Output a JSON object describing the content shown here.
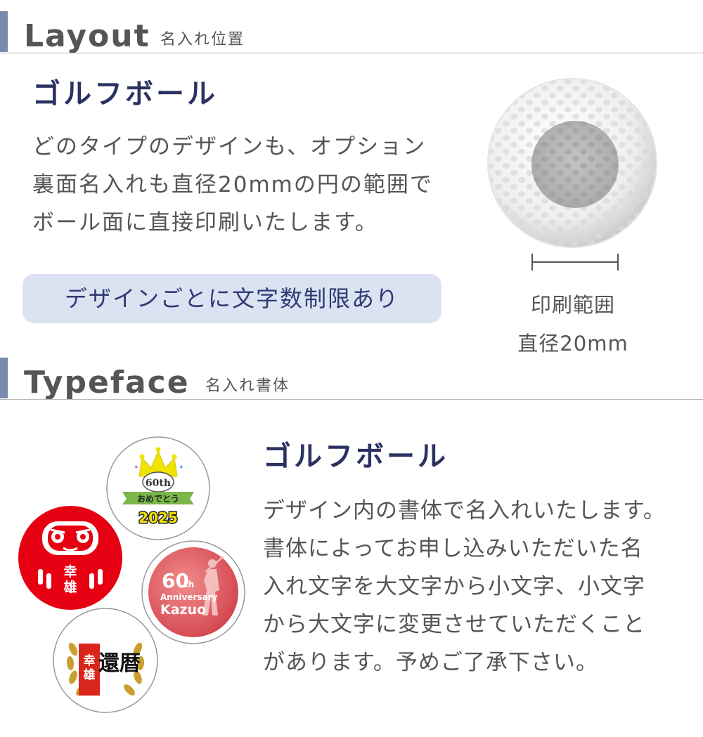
{
  "layout_section": {
    "title_en": "Layout",
    "title_jp": "名入れ位置",
    "heading": "ゴルフボール",
    "body_lines": [
      "どのタイプのデザインも、オプション",
      "裏面名入れも直径20mmの円の範囲で",
      "ボール面に直接印刷いたします。"
    ],
    "notice": "デザインごとに文字数制限あり",
    "print_area_label": "印刷範囲",
    "print_area_size": "直径20mm"
  },
  "typeface_section": {
    "title_en": "Typeface",
    "title_jp": "名入れ書体",
    "heading": "ゴルフボール",
    "body_lines": [
      "デザイン内の書体で名入れいたします。",
      "書体によってお申し込みいただいた名",
      "入れ文字を大文字から小文字、小文字",
      "から大文字に変更させていただくこと",
      "があります。予めご了承下さい。"
    ]
  },
  "samples": {
    "crown": {
      "line1": "60th",
      "line2": "おめでとう",
      "line3": "2025",
      "icon": "crown-icon"
    },
    "daruma": {
      "name": "幸雄",
      "icon": "daruma-icon"
    },
    "golfer": {
      "line1": "60",
      "line1_suffix": "th",
      "line2": "Anniversary",
      "line3": "Kazuo",
      "icon": "golfer-icon"
    },
    "kanreki": {
      "title": "還暦",
      "name": "幸雄",
      "icon": "laurel-wreath-icon"
    }
  },
  "colors": {
    "heading_navy": "#2b3262",
    "section_bar": "#7a8aae",
    "pill_bg": "#dbe3f2",
    "daruma_red": "#e60012",
    "golfer_red": "#d9534f",
    "crown_yellow": "#f2e200",
    "ribbon_green": "#7ab648",
    "gold": "#c9a030"
  }
}
